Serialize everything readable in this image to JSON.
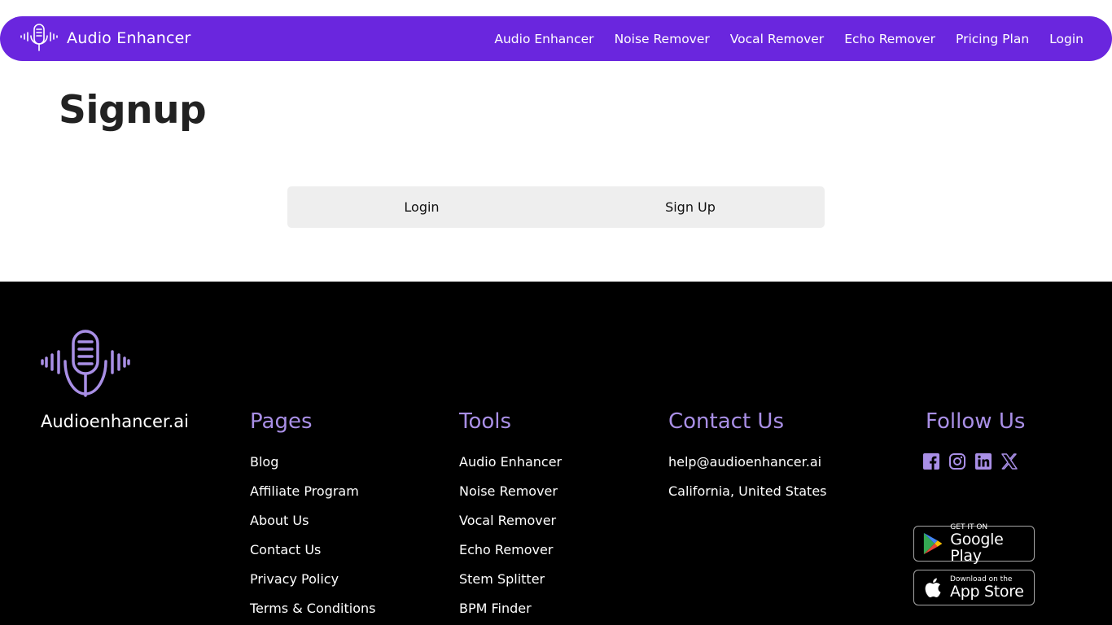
{
  "nav": {
    "brand": "Audio Enhancer",
    "links": [
      "Audio Enhancer",
      "Noise Remover",
      "Vocal Remover",
      "Echo Remover",
      "Pricing Plan",
      "Login"
    ]
  },
  "page": {
    "title": "Signup"
  },
  "auth_tabs": {
    "login": "Login",
    "signup": "Sign Up"
  },
  "footer": {
    "brand": "Audioenhancer.ai",
    "pages": {
      "title": "Pages",
      "links": [
        "Blog",
        "Affiliate Program",
        "About Us",
        "Contact Us",
        "Privacy Policy",
        "Terms & Conditions"
      ]
    },
    "tools": {
      "title": "Tools",
      "links": [
        "Audio Enhancer",
        "Noise Remover",
        "Vocal Remover",
        "Echo Remover",
        "Stem Splitter",
        "BPM Finder"
      ]
    },
    "contact": {
      "title": "Contact Us",
      "email": "help@audioenhancer.ai",
      "location": "California, United States"
    },
    "follow": {
      "title": "Follow Us",
      "icons": [
        "facebook-icon",
        "instagram-icon",
        "linkedin-icon",
        "x-icon"
      ]
    },
    "google_play": {
      "small": "GET IT ON",
      "big": "Google Play"
    },
    "app_store": {
      "small": "Download on the",
      "big": "App Store"
    }
  },
  "colors": {
    "nav_bg": "#6a26de",
    "accent": "#a98fe6",
    "footer_bg": "#000000"
  }
}
